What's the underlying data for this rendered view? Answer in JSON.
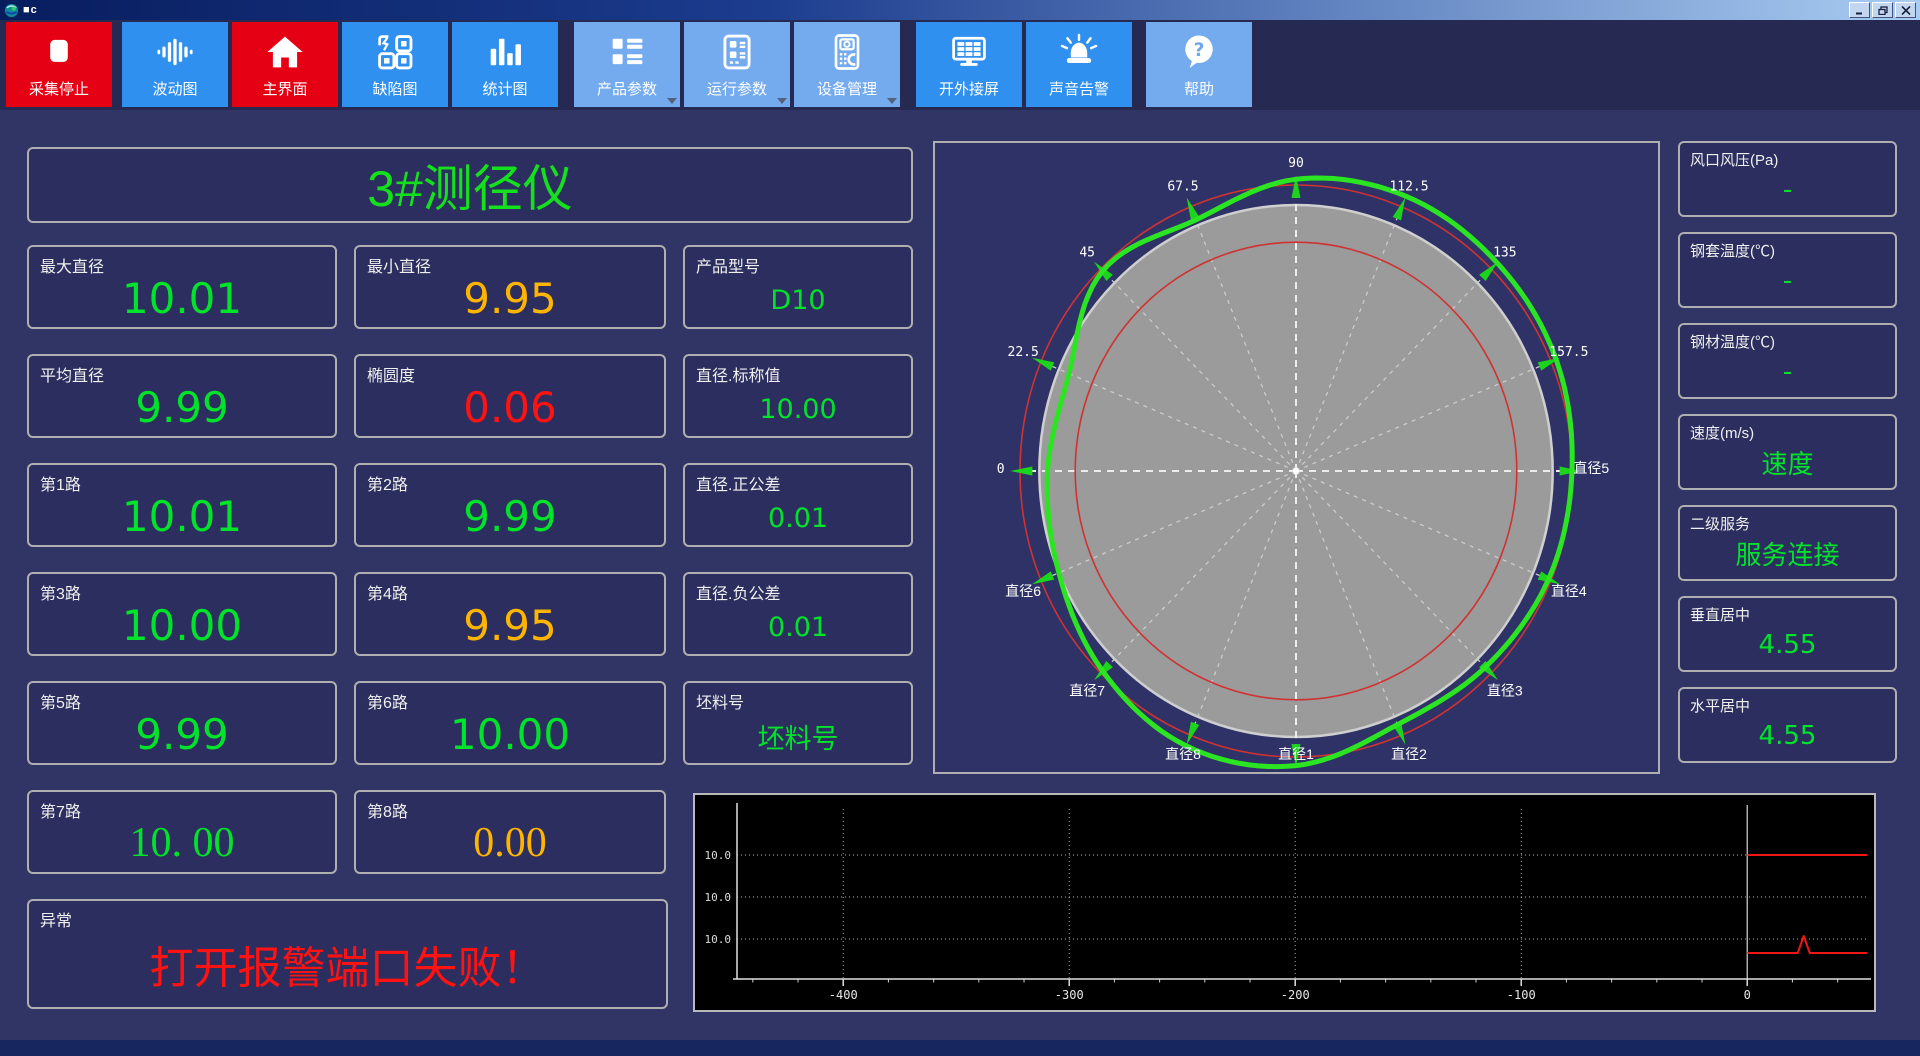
{
  "window": {
    "title": "■c"
  },
  "colors": {
    "green": "#00e32b",
    "orange": "#ffb400",
    "red": "#ff1212"
  },
  "toolbar": {
    "buttons": [
      {
        "name": "stop-acquisition",
        "label": "采集停止",
        "style": "red",
        "icon": "stop",
        "gap_after": 10
      },
      {
        "name": "wave-chart",
        "label": "波动图",
        "style": "blue",
        "icon": "waveform",
        "gap_after": 4
      },
      {
        "name": "main-screen",
        "label": "主界面",
        "style": "red",
        "icon": "home",
        "gap_after": 4
      },
      {
        "name": "defect-chart",
        "label": "缺陷图",
        "style": "blue",
        "icon": "defect-grid",
        "gap_after": 4
      },
      {
        "name": "statistics-chart",
        "label": "统计图",
        "style": "blue",
        "icon": "bar-chart",
        "gap_after": 16
      },
      {
        "name": "product-params",
        "label": "产品参数",
        "style": "light",
        "icon": "product-list",
        "dropdown": true,
        "gap_after": 4
      },
      {
        "name": "run-params",
        "label": "运行参数",
        "style": "light",
        "icon": "run-params",
        "dropdown": true,
        "gap_after": 4
      },
      {
        "name": "device-manage",
        "label": "设备管理",
        "style": "light",
        "icon": "device-manage",
        "dropdown": true,
        "gap_after": 16
      },
      {
        "name": "external-screen",
        "label": "开外接屏",
        "style": "blue",
        "icon": "external-screen",
        "gap_after": 4
      },
      {
        "name": "sound-alarm",
        "label": "声音告警",
        "style": "blue",
        "icon": "siren",
        "gap_after": 14
      },
      {
        "name": "help",
        "label": "帮助",
        "style": "light",
        "icon": "help",
        "gap_after": 0
      }
    ]
  },
  "metrics": {
    "title": "3#测径仪",
    "cells": [
      {
        "name": "max-diameter",
        "label": "最大直径",
        "value": "10.01",
        "color": "green",
        "col": 1,
        "row": 1
      },
      {
        "name": "min-diameter",
        "label": "最小直径",
        "value": "9.95",
        "color": "orange",
        "col": 2,
        "row": 1
      },
      {
        "name": "product-model",
        "label": "产品型号",
        "value": "D10",
        "color": "green",
        "col": 3,
        "row": 1,
        "small": true
      },
      {
        "name": "avg-diameter",
        "label": "平均直径",
        "value": "9.99",
        "color": "green",
        "col": 1,
        "row": 2
      },
      {
        "name": "ovality",
        "label": "椭圆度",
        "value": "0.06",
        "color": "red",
        "col": 2,
        "row": 2
      },
      {
        "name": "diameter-nominal",
        "label": "直径.标称值",
        "value": "10.00",
        "color": "green",
        "col": 3,
        "row": 2,
        "small": true
      },
      {
        "name": "path-1",
        "label": "第1路",
        "value": "10.01",
        "color": "green",
        "col": 1,
        "row": 3
      },
      {
        "name": "path-2",
        "label": "第2路",
        "value": "9.99",
        "color": "green",
        "col": 2,
        "row": 3
      },
      {
        "name": "diameter-plus-tol",
        "label": "直径.正公差",
        "value": "0.01",
        "color": "green",
        "col": 3,
        "row": 3,
        "small": true
      },
      {
        "name": "path-3",
        "label": "第3路",
        "value": "10.00",
        "color": "green",
        "col": 1,
        "row": 4
      },
      {
        "name": "path-4",
        "label": "第4路",
        "value": "9.95",
        "color": "orange",
        "col": 2,
        "row": 4
      },
      {
        "name": "diameter-minus-tol",
        "label": "直径.负公差",
        "value": "0.01",
        "color": "green",
        "col": 3,
        "row": 4,
        "small": true
      },
      {
        "name": "path-5",
        "label": "第5路",
        "value": "9.99",
        "color": "green",
        "col": 1,
        "row": 5
      },
      {
        "name": "path-6",
        "label": "第6路",
        "value": "10.00",
        "color": "green",
        "col": 2,
        "row": 5
      },
      {
        "name": "billet-no",
        "label": "坯料号",
        "value": "坯料号",
        "color": "green",
        "col": 3,
        "row": 5,
        "small": true
      },
      {
        "name": "path-7",
        "label": "第7路",
        "value": "10. 00",
        "color": "green",
        "col": 1,
        "row": 6,
        "serif": true
      },
      {
        "name": "path-8",
        "label": "第8路",
        "value": "0.00",
        "color": "orange",
        "col": 2,
        "row": 6,
        "serif": true
      }
    ],
    "alarm": {
      "label": "异常",
      "value": "打开报警端口失败！"
    }
  },
  "side_info": [
    {
      "name": "tuyere-pressure",
      "label": "风口风压(Pa)",
      "value": "-"
    },
    {
      "name": "sleeve-temperature",
      "label": "钢套温度(℃)",
      "value": "-"
    },
    {
      "name": "steel-temperature",
      "label": "钢材温度(℃)",
      "value": "-"
    },
    {
      "name": "speed",
      "label": "速度(m/s)",
      "value": "速度"
    },
    {
      "name": "secondary-service",
      "label": "二级服务",
      "value": "服务连接"
    },
    {
      "name": "vertical-center",
      "label": "垂直居中",
      "value": "4.55"
    },
    {
      "name": "horizontal-center",
      "label": "水平居中",
      "value": "4.55"
    }
  ],
  "chart_data": [
    {
      "type": "polar-profile",
      "title": "直径截面轮廓",
      "angle_labels": [
        {
          "deg": 180,
          "text": "0"
        },
        {
          "deg": 157.5,
          "text": "22.5"
        },
        {
          "deg": 135,
          "text": "45"
        },
        {
          "deg": 112.5,
          "text": "67.5"
        },
        {
          "deg": 90,
          "text": "90"
        },
        {
          "deg": 67.5,
          "text": "112.5"
        },
        {
          "deg": 45,
          "text": "135"
        },
        {
          "deg": 22.5,
          "text": "157.5"
        }
      ],
      "diameter_labels": [
        {
          "deg": 0,
          "text": "直径5"
        },
        {
          "deg": 337.5,
          "text": "直径4"
        },
        {
          "deg": 315,
          "text": "直径3"
        },
        {
          "deg": 292.5,
          "text": "直径2"
        },
        {
          "deg": 270,
          "text": "直径1"
        },
        {
          "deg": 247.5,
          "text": "直径8"
        },
        {
          "deg": 225,
          "text": "直径7"
        },
        {
          "deg": 202.5,
          "text": "直径6"
        }
      ],
      "rings": {
        "outer_tolerance": 1.0,
        "body": 0.93,
        "inner_tolerance": 0.8
      },
      "profile": {
        "angles_deg": [
          0,
          22.5,
          45,
          67.5,
          90,
          112.5,
          135,
          157.5,
          180,
          202.5,
          225,
          247.5,
          270,
          292.5,
          315,
          337.5
        ],
        "radii_rel": [
          1.0,
          1.02,
          1.03,
          1.04,
          1.02,
          0.95,
          0.99,
          0.89,
          0.9,
          0.93,
          0.99,
          1.04,
          1.03,
          0.96,
          0.97,
          0.99
        ]
      },
      "colors": {
        "profile": "#2ce522",
        "rings": "#d03232",
        "body_fill": "#9b9b9b",
        "body_rim": "#cfcfcf",
        "spokes": "#cccccc",
        "arrows": "#1dd41d",
        "labels": "#ffffff"
      }
    },
    {
      "type": "line",
      "bg": "#000000",
      "x_ticks": [
        -400,
        -300,
        -200,
        -100,
        0
      ],
      "x_range": [
        -447,
        53
      ],
      "x_minor_step": 20,
      "y_gridlines": [
        {
          "label": "10.0"
        },
        {
          "label": "10.0"
        },
        {
          "label": "10.0"
        }
      ],
      "series": [
        {
          "name": "upper-line",
          "color": "#f01616",
          "x_start": 0,
          "x_end": 53,
          "row": "gridline-1"
        },
        {
          "name": "lower-line",
          "color": "#f01616",
          "x_start": 0,
          "x_end": 53,
          "row": "below-gridline-3",
          "spike_x": 25
        }
      ],
      "axis_color": "#e0e0e0",
      "grid_color": "#a8a8a8",
      "zero_line_color": "#d8d8d8"
    }
  ]
}
